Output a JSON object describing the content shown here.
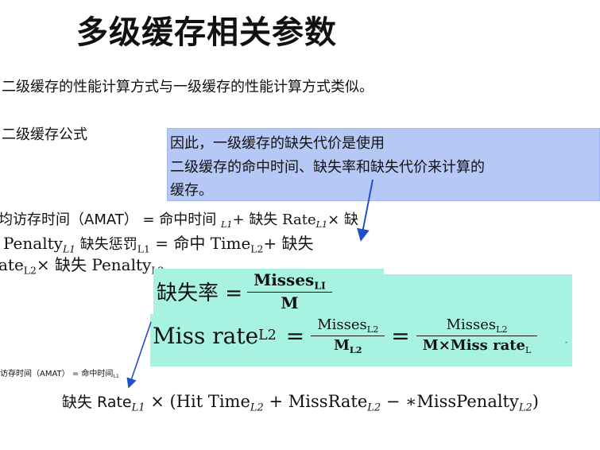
{
  "slide": {
    "title": "多级缓存相关参数",
    "para1": "二级缓存的性能计算方式与一级缓存的性能计算方式类似。",
    "para2": "二级缓存公式"
  },
  "note": {
    "line1": "因此，一级缓存的缺失代价是使用",
    "line2": "二级缓存的命中时间、缺失率和缺失代价来计算的",
    "line3": "缓存。"
  },
  "formula1": {
    "l1_prefix": "均访存时间（AMAT） = 命中时间",
    "l1_sub": "L1",
    "l1_plus": "+ 缺失 Rate",
    "l1_sub2": "L1",
    "l1_times": "× 缺",
    "l2_penalty": "Penalty",
    "l2_sub": "L1",
    "l2_mid": " 缺失惩罚",
    "l2_sub2": "L1",
    "l2_eq": " = 命中 Time",
    "l2_sub3": "L2",
    "l2_plus": "+ 缺失",
    "l3_rate": "ate",
    "l3_sub": "L2",
    "l3_times": "× 缺失 Penalty",
    "l3_sub2": "L2"
  },
  "formula2": {
    "lhs": "缺失率 =",
    "num": "Misses",
    "num_sub": "LI",
    "den": "M"
  },
  "formula3": {
    "lhs": "Miss rate",
    "lhs_sub": "L2",
    "eq": "=",
    "f1_num": "Misses",
    "f1_num_sub": "L2",
    "f1_den": "M",
    "f1_den_sub": "L2",
    "eq2": "=",
    "f2_num": "Misses",
    "f2_num_sub": "L2",
    "f2_den_a": "M",
    "f2_den_b": "×Miss rate",
    "f2_den_sub": "L",
    "edge_mark": "-"
  },
  "small_label": {
    "text": "访存时间（AMAT） = 命中时间",
    "sub": "L1"
  },
  "formula4": {
    "a": "缺失 Rate",
    "a_sub": "L1",
    "b": " × (Hit Time",
    "b_sub": "L2",
    "c": " + MissRate",
    "c_sub": "L2",
    "d": " − ∗MissPenalty",
    "d_sub": "L2",
    "e": ")"
  },
  "colors": {
    "note_bg": "#b6c8f5",
    "formula_bg": "#a7f2e1",
    "arrow": "#2050c8"
  }
}
